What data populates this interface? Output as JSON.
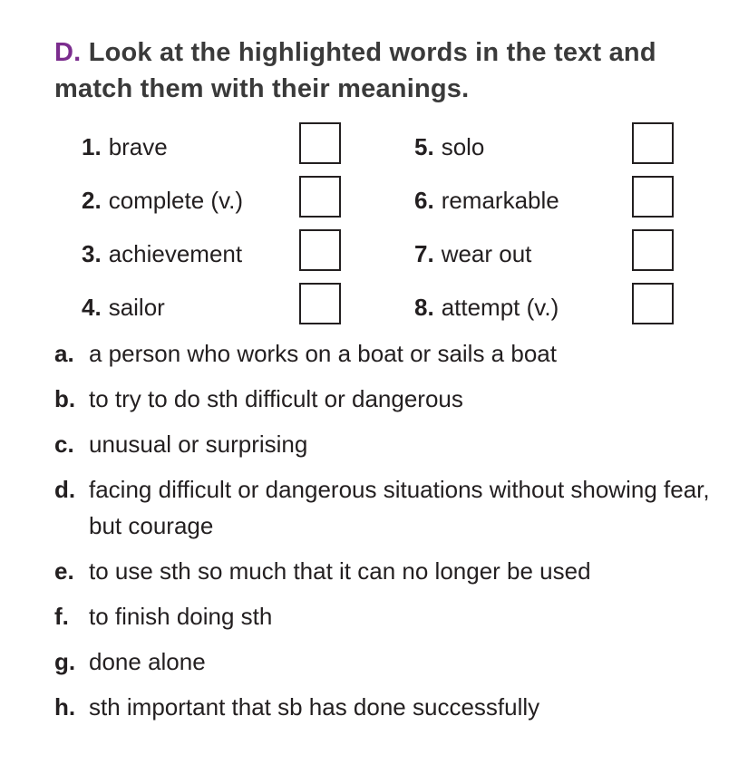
{
  "exercise": {
    "letter": "D",
    "instruction": "Look at the highlighted words in the text and match them with their meanings."
  },
  "words": [
    {
      "num": "1.",
      "word": "brave"
    },
    {
      "num": "2.",
      "word": "complete (v.)"
    },
    {
      "num": "3.",
      "word": "achievement"
    },
    {
      "num": "4.",
      "word": "sailor"
    },
    {
      "num": "5.",
      "word": "solo"
    },
    {
      "num": "6.",
      "word": "remarkable"
    },
    {
      "num": "7.",
      "word": "wear out"
    },
    {
      "num": "8.",
      "word": "attempt (v.)"
    }
  ],
  "definitions": [
    {
      "letter": "a.",
      "text": "a person who works on a boat or sails a boat"
    },
    {
      "letter": "b.",
      "text": "to try to do sth difficult or dangerous"
    },
    {
      "letter": "c.",
      "text": "unusual or surprising"
    },
    {
      "letter": "d.",
      "text": "facing difficult or dangerous situations without showing fear, but courage"
    },
    {
      "letter": "e.",
      "text": "to use sth so much that it can no longer be used"
    },
    {
      "letter": "f.",
      "text": "to finish doing sth"
    },
    {
      "letter": "g.",
      "text": "done alone"
    },
    {
      "letter": "h.",
      "text": "sth important that sb has done successfully"
    }
  ],
  "colors": {
    "accent": "#7b2d8e",
    "heading": "#3a3a3a",
    "text": "#231f20"
  }
}
